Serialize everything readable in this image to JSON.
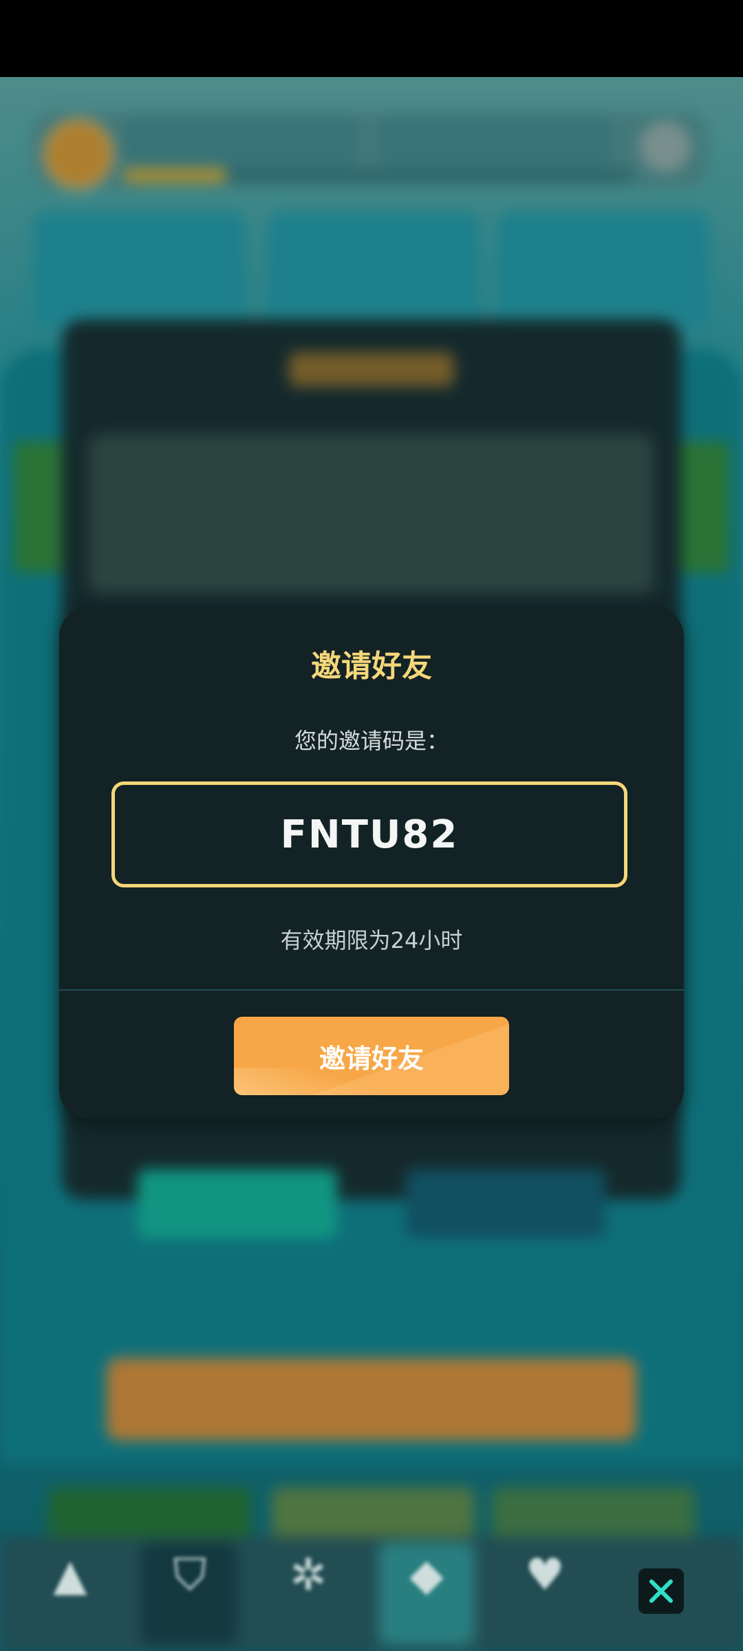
{
  "modal": {
    "title": "邀请好友",
    "subtitle": "您的邀请码是：",
    "invite_code": "FNTU82",
    "validity": "有效期限为24小时",
    "button_label": "邀请好友"
  },
  "close_button": {
    "icon": "close-icon"
  },
  "colors": {
    "accent_gold": "#f5d77a",
    "button_orange": "#f7a747",
    "modal_bg": "#132224"
  }
}
